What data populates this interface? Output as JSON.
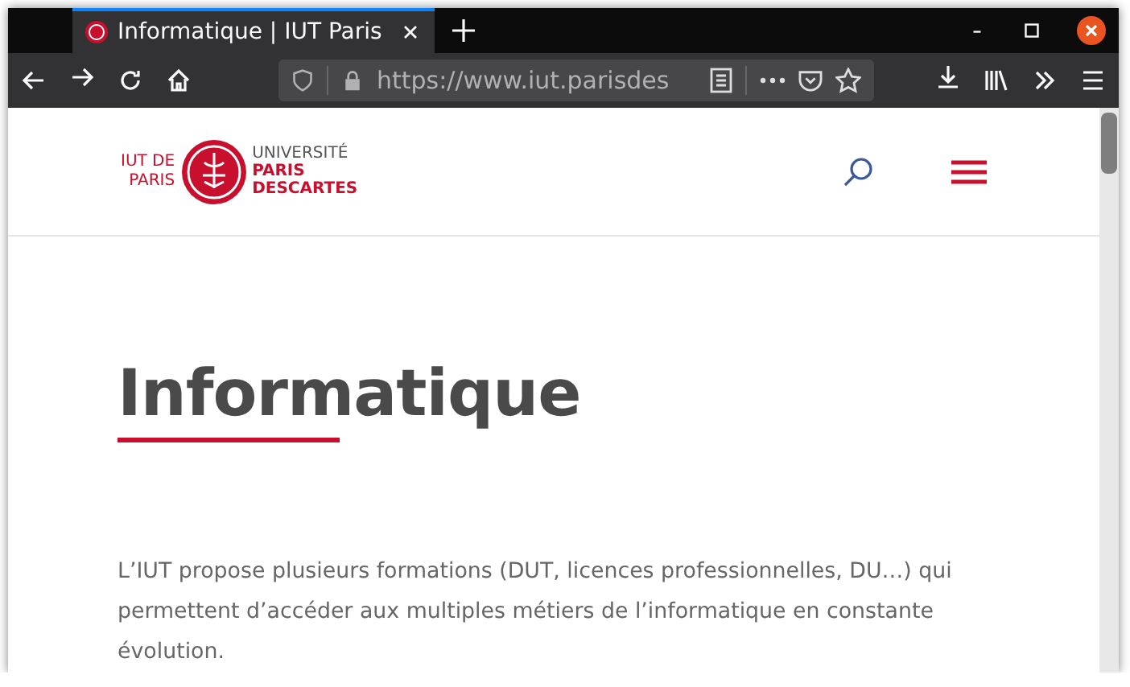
{
  "browser": {
    "tab_title": "Informatique | IUT Paris",
    "url": "https://www.iut.parisdes"
  },
  "logo": {
    "left": [
      "IUT DE",
      "PARIS"
    ],
    "top": "UNIVERSITÉ",
    "bottom": [
      "PARIS",
      "DESCARTES"
    ]
  },
  "heading": "Informatique",
  "paragraph": "L’IUT propose plusieurs formations (DUT, licences professionnelles, DU…) qui permettent d’accéder aux multiples métiers de l’informatique en constante évolution."
}
